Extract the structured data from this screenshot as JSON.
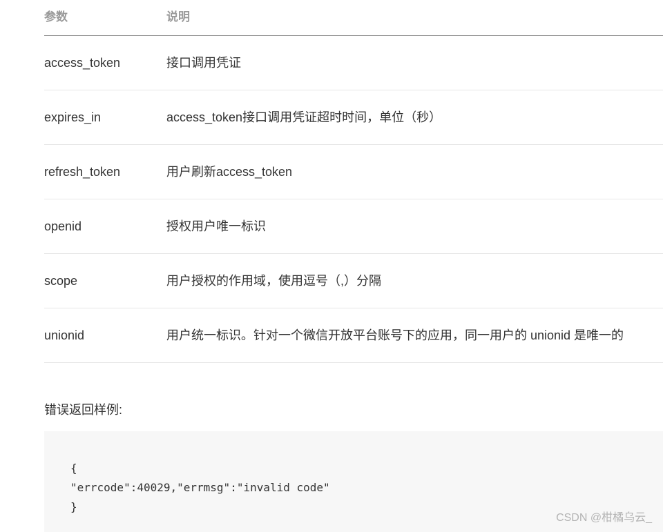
{
  "table": {
    "headers": {
      "param": "参数",
      "desc": "说明"
    },
    "rows": [
      {
        "param": "access_token",
        "desc": "接口调用凭证"
      },
      {
        "param": "expires_in",
        "desc": "access_token接口调用凭证超时时间，单位（秒）"
      },
      {
        "param": "refresh_token",
        "desc": "用户刷新access_token"
      },
      {
        "param": "openid",
        "desc": "授权用户唯一标识"
      },
      {
        "param": "scope",
        "desc": "用户授权的作用域，使用逗号（,）分隔"
      },
      {
        "param": "unionid",
        "desc": "用户统一标识。针对一个微信开放平台账号下的应用，同一用户的 unionid 是唯一的"
      }
    ]
  },
  "error_example": {
    "label": "错误返回样例:",
    "code_lines": [
      "{",
      "\"errcode\":40029,\"errmsg\":\"invalid code\"",
      "}"
    ]
  },
  "watermark": "CSDN @柑橘乌云_"
}
